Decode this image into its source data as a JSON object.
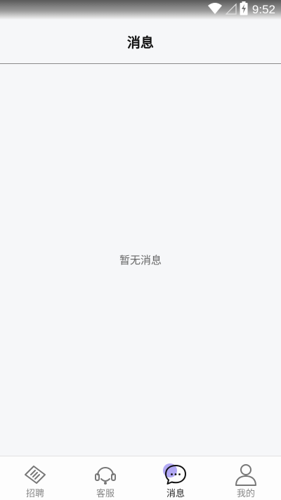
{
  "status_bar": {
    "time": "9:52",
    "icons": [
      "wifi-icon",
      "signal-icon",
      "battery-charging-icon"
    ]
  },
  "header": {
    "title": "消息"
  },
  "main": {
    "empty_message": "暂无消息"
  },
  "tabbar": {
    "tabs": [
      {
        "label": "招聘",
        "icon": "handshake-icon",
        "active": false
      },
      {
        "label": "客服",
        "icon": "headset-icon",
        "active": false
      },
      {
        "label": "消息",
        "icon": "chat-bubble-icon",
        "active": true
      },
      {
        "label": "我的",
        "icon": "person-icon",
        "active": false
      }
    ]
  },
  "colors": {
    "background": "#f6f7f9",
    "accent_dot": "#a59af2",
    "tab_label": "#888888",
    "tab_label_active": "#222222"
  }
}
